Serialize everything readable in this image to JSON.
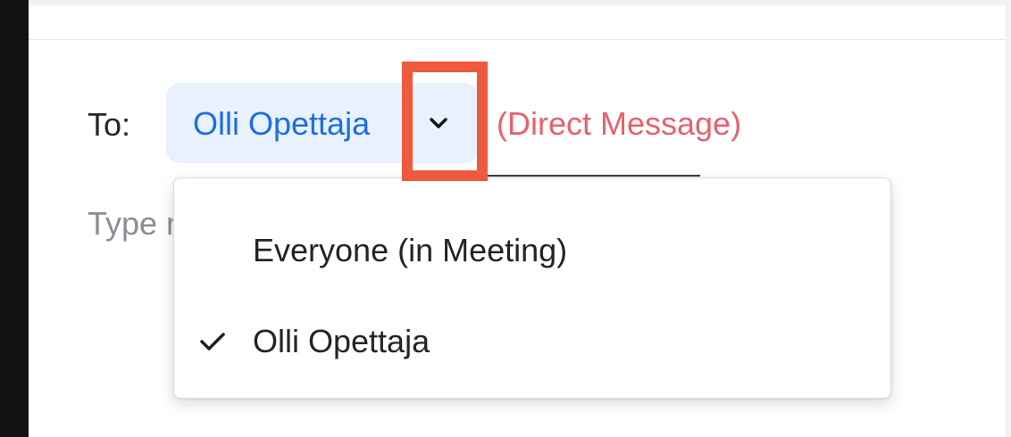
{
  "chat": {
    "to_label": "To:",
    "recipient": "Olli Opettaja",
    "recipient_icon": "chevron-down-icon",
    "direct_message": "(Direct Message)",
    "message_placeholder": "Type message here..."
  },
  "dropdown": {
    "items": [
      {
        "label": "Everyone (in Meeting)",
        "selected": false
      },
      {
        "label": "Olli Opettaja",
        "selected": true,
        "icon": "check-icon"
      }
    ]
  },
  "colors": {
    "chip_background": "#e8f1fd",
    "accent_blue": "#1b6fe0",
    "direct_message": "#e8616f",
    "highlight": "#ef5a3c"
  }
}
